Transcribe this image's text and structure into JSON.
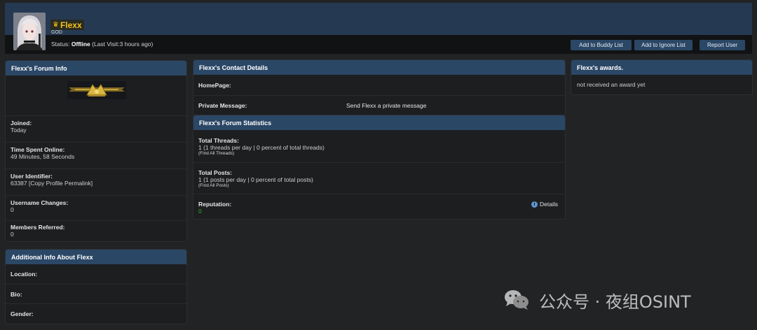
{
  "profile": {
    "username": "Flexx",
    "rank": "GOD",
    "status_prefix": "Status: ",
    "status_value": "Offline",
    "last_visit": " (Last Visit:3 hours ago)",
    "buttons": [
      "Add to Buddy List",
      "Add to Ignore List",
      "Report User"
    ]
  },
  "forum_info": {
    "title": "Flexx's Forum Info",
    "rows": [
      {
        "label": "Joined:",
        "value": "Today"
      },
      {
        "label": "Time Spent Online:",
        "value": "49 Minutes, 58 Seconds"
      },
      {
        "label": "User Identifier:",
        "value": "63387 [Copy Profile Permalink]"
      },
      {
        "label": "Username Changes:",
        "value": "0"
      },
      {
        "label": "Members Referred:",
        "value": "0"
      }
    ]
  },
  "additional_info": {
    "title": "Additional Info About Flexx",
    "rows": [
      "Location:",
      "Bio:",
      "Gender:"
    ]
  },
  "contact": {
    "title": "Flexx's Contact Details",
    "homepage_label": "HomePage:",
    "pm_label": "Private Message:",
    "pm_link": "Send Flexx a private message"
  },
  "statistics": {
    "title": "Flexx's Forum Statistics",
    "threads_label": "Total Threads:",
    "threads_value": "1 (1 threads per day | 0 percent of total threads)",
    "threads_link": "(Find All Threads)",
    "posts_label": "Total Posts:",
    "posts_value": "1 (1 posts per day | 0 percent of total posts)",
    "posts_link": "(Find All Posts)",
    "rep_label": "Reputation:",
    "rep_value": "0",
    "details_label": "Details"
  },
  "awards": {
    "title": "Flexx's awards.",
    "empty_text": "not received an award yet"
  },
  "watermark": {
    "text": "公众号 · 夜组OSINT"
  },
  "colors": {
    "header_band": "#253a52",
    "panel_head": "#2b4766",
    "username": "#f3c41c",
    "reputation": "#3aa635"
  },
  "icons": [
    "crown-icon",
    "info-icon",
    "wechat-icon"
  ]
}
